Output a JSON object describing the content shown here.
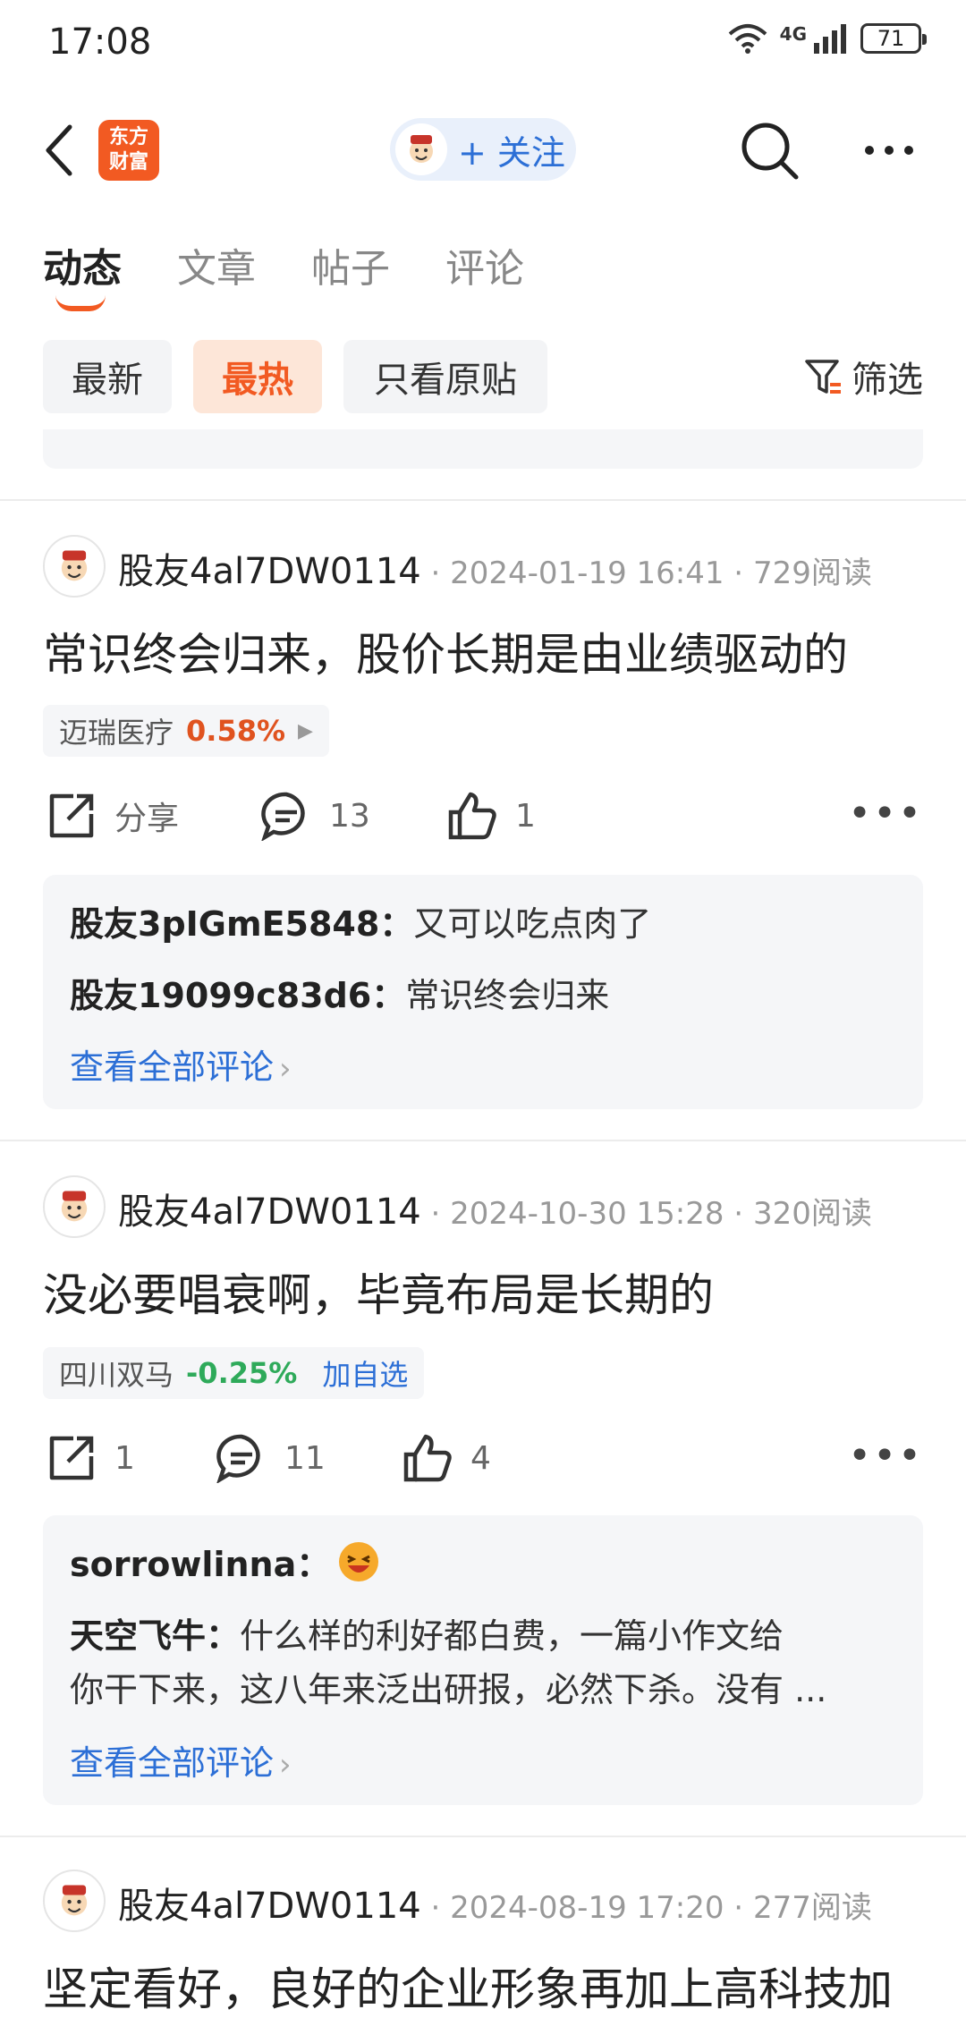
{
  "status_bar": {
    "time": "17:08",
    "network": "4G",
    "battery": "71"
  },
  "header": {
    "logo_line1": "东方",
    "logo_line2": "财富",
    "follow_label": "+ 关注"
  },
  "tabs": [
    {
      "label": "动态"
    },
    {
      "label": "文章"
    },
    {
      "label": "帖子"
    },
    {
      "label": "评论"
    }
  ],
  "filters": [
    {
      "label": "最新"
    },
    {
      "label": "最热"
    },
    {
      "label": "只看原贴"
    }
  ],
  "filter_button": "筛选",
  "posts": [
    {
      "author": "股友4al7DW0114",
      "date": "2024-01-19 16:41",
      "reads": "729阅读",
      "title": "常识终会归来，股价长期是由业绩驱动的",
      "stock_name": "迈瑞医疗",
      "stock_change": "0.58%",
      "share": "分享",
      "comments": "13",
      "likes": "1",
      "replies": [
        {
          "user": "股友3pIGmE5848：",
          "text": "又可以吃点肉了"
        },
        {
          "user": "股友19099c83d6：",
          "text": "常识终会归来"
        }
      ],
      "view_all": "查看全部评论"
    },
    {
      "author": "股友4al7DW0114",
      "date": "2024-10-30 15:28",
      "reads": "320阅读",
      "title": "没必要唱衰啊，毕竟布局是长期的",
      "stock_name": "四川双马",
      "stock_change": "-0.25%",
      "add_watch": "加自选",
      "share": "1",
      "comments": "11",
      "likes": "4",
      "replies": [
        {
          "user": "sorrowlinna：",
          "text": ""
        },
        {
          "user": "天空飞牛：",
          "text": "什么样的利好都白费，一篇小作文给",
          "text2": "你干下来，这八年来泛出研报，必然下杀。没有 ..."
        }
      ],
      "view_all": "查看全部评论"
    },
    {
      "author": "股友4al7DW0114",
      "date": "2024-08-19 17:20",
      "reads": "277阅读",
      "title": "坚定看好，良好的企业形象再加上高科技加"
    }
  ],
  "colors": {
    "brand": "#f25a22",
    "link": "#2c6fd6",
    "up": "#e0531f",
    "down": "#2eaa5a"
  }
}
